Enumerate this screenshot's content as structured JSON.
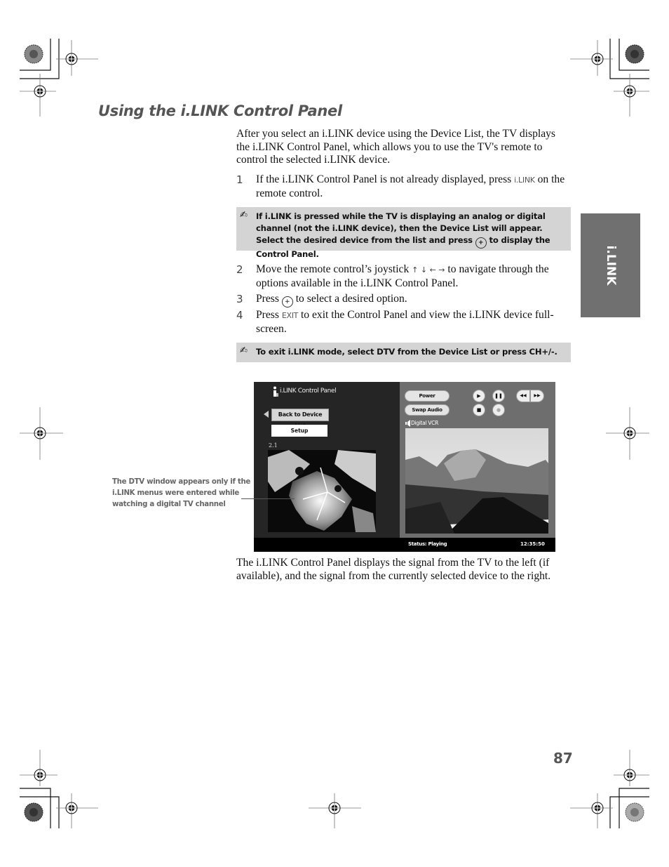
{
  "page": {
    "title": "Using the i.LINK Control Panel",
    "intro": "After you select an i.LINK device using the Device List, the TV displays the i.LINK Control Panel, which allows you to use the TV's remote to control the selected i.LINK device.",
    "steps": [
      {
        "num": "1",
        "pre": "If the i.LINK Control Panel is not already displayed, press ",
        "key": "i.LINK",
        "post": " on the remote control."
      },
      {
        "num": "2",
        "pre": "Move the remote control’s joystick ",
        "arrows": "↑ ↓ ← →",
        "post": " to navigate through the options available in the i.LINK Control Panel."
      },
      {
        "num": "3",
        "pre": "Press ",
        "post": " to select a desired option."
      },
      {
        "num": "4",
        "pre": "Press ",
        "key": "EXIT",
        "post": " to exit the Control Panel and view the i.LINK device full-screen."
      }
    ],
    "notes": [
      {
        "icon": "note-pencil-icon",
        "pre": "If i.LINK is pressed while the TV is displaying an analog or digital channel (not the i.LINK device), then the Device List will appear. Select the desired device from the list and press ",
        "post": " to display the Control Panel."
      },
      {
        "icon": "note-pencil-icon",
        "text": "To exit i.LINK mode, select DTV from the Device List or press CH+/-."
      }
    ],
    "side_tab": "i.LINK",
    "callout": "The DTV window appears only if the i.LINK menus were entered while watching a digital TV channel",
    "caption": "The i.LINK Control Panel displays the signal from the TV to the left (if available), and the signal from the currently selected device to the right.",
    "page_number": "87",
    "pencil_glyph": "✍",
    "select_glyph": "+"
  },
  "screen": {
    "panel_title": "i.LINK Control Panel",
    "back_button": "Back to Device List",
    "setup_button": "Setup",
    "channel": "2.1",
    "power_button": "Power",
    "swap_audio_button": "Swap Audio",
    "source_label": "Digital VCR",
    "status": "Status: Playing",
    "time": "12:35:50",
    "transport": {
      "play": "▶",
      "pause": "❚❚",
      "rewind": "◀◀",
      "ffwd": "▶▶",
      "stop": "■",
      "record": "●"
    }
  }
}
